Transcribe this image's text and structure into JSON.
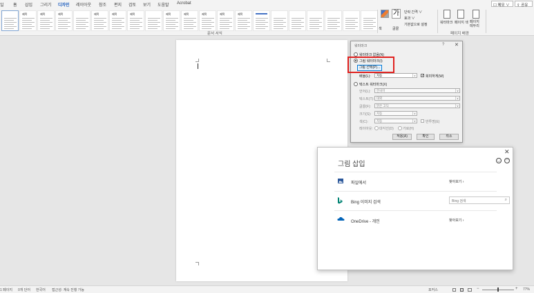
{
  "menubar": {
    "items": [
      "일",
      "홈",
      "삽입",
      "그리기",
      "디자인",
      "레이아웃",
      "참조",
      "편지",
      "검토",
      "보기",
      "도움말",
      "Acrobat"
    ],
    "active_index": 4,
    "memo_label": "☐ 메모 ∨",
    "share_label": "⇪ 공유 ∨"
  },
  "ribbon": {
    "group_label": "문서 서식",
    "right_group_label": "페이지 배경",
    "style_titles": [
      "",
      "제목",
      "제목",
      "제목",
      "",
      "제목",
      "제목",
      "제목",
      "",
      "제목",
      "제목",
      "제목",
      "제목",
      "제목",
      "",
      "",
      "",
      "",
      "",
      "",
      ""
    ],
    "paragraph_spacing": "단락 간격 ∨",
    "effects": "효과 ∨",
    "set_default": "기본값으로 설정",
    "colors_label": "색",
    "fonts_label": "글꼴",
    "watermark_label": "워터마크",
    "page_color_label": "페이지 색",
    "page_border_label": "페이지 테두리"
  },
  "watermark_dialog": {
    "title": "워터마크",
    "help": "?",
    "close": "✕",
    "option_none": "워터마크 없음(N)",
    "option_picture": "그림 워터마크(I)",
    "pick_button": "그림 선택(P)...",
    "scale_label": "배율(L):",
    "scale_value": "자동",
    "washout_label": "희미하게(W)",
    "option_text": "텍스트 워터마크(X)",
    "language_label": "언어(L):",
    "language_value": "한국어",
    "text_label": "텍스트(T):",
    "text_value": "대외",
    "font_label": "글꼴(F):",
    "font_value": "맑은 고딕",
    "size_label": "크기(S):",
    "size_value": "자동",
    "color_label": "색(C):",
    "color_value": "자동",
    "semi_label": "반투명(E)",
    "layout_label": "레이아웃:",
    "diagonal_label": "대각선(D)",
    "horizontal_label": "가로(H)",
    "apply_button": "적용(A)",
    "ok_button": "확인",
    "cancel_button": "취소"
  },
  "insert_panel": {
    "title": "그림 삽입",
    "close": "✕",
    "rows": [
      {
        "label": "파일에서",
        "action": "찾아보기 ›"
      },
      {
        "label": "Bing 이미지 검색",
        "placeholder": "Bing 검색"
      },
      {
        "label": "OneDrive - 개인",
        "action": "찾아보기 ›"
      }
    ]
  },
  "statusbar": {
    "page": "1 페이지",
    "words": "0개 단어",
    "language": "한국어",
    "accessibility": "접근성: 계속 진행 가능",
    "focus": "포커스",
    "zoom": "77%"
  },
  "colors": {
    "accent": "#185abd",
    "highlight_box": "#e0201e"
  }
}
